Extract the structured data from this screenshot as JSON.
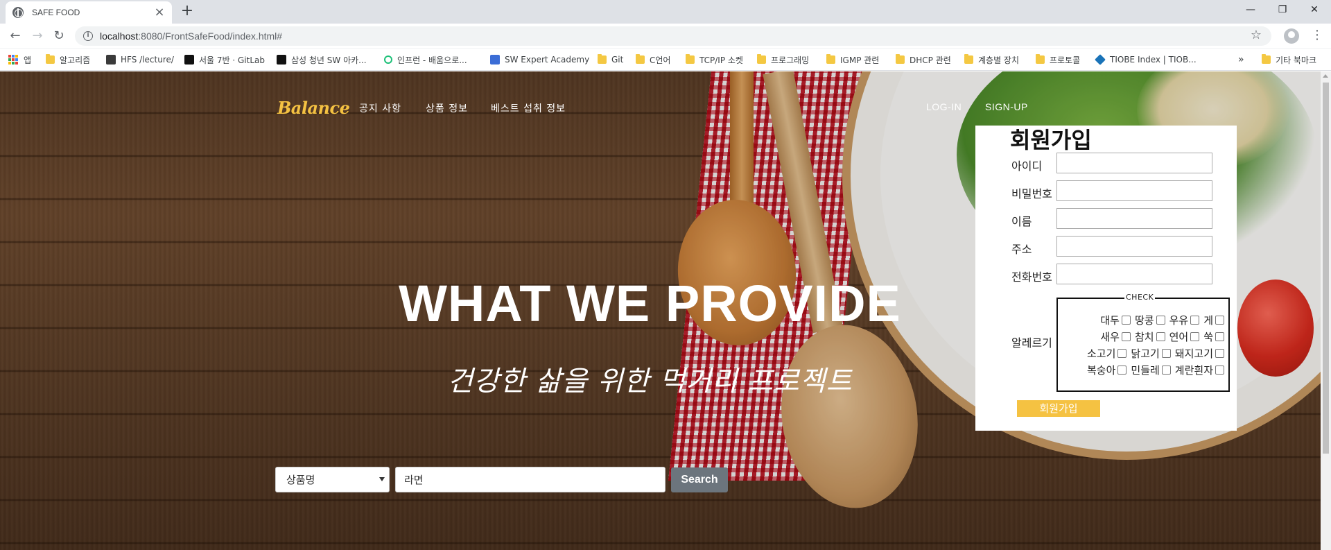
{
  "browser": {
    "tab_title": "SAFE FOOD",
    "tab_close": "×",
    "new_tab": "+",
    "url_host": "localhost",
    "url_path": ":8080/FrontSafeFood/index.html#",
    "window_controls": {
      "minimize": "—",
      "restore": "❐",
      "close": "✕"
    },
    "nav": {
      "back": "←",
      "forward": "→",
      "reload": "↻"
    },
    "star": "☆",
    "menu": "⋮"
  },
  "bookmarks": {
    "items": [
      {
        "label": "앱",
        "icon": "apps-icon"
      },
      {
        "label": "알고리즘",
        "icon": "folder-icon"
      },
      {
        "label": "HFS /lecture/",
        "icon": "hfs-icon"
      },
      {
        "label": "서울 7반 · GitLab",
        "icon": "gitlab-icon"
      },
      {
        "label": "삼성 청년 SW 아카...",
        "icon": "ssafy-icon"
      },
      {
        "label": "인프런 - 배움으로...",
        "icon": "inflearn-icon"
      },
      {
        "label": "SW Expert Academy",
        "icon": "swea-icon"
      },
      {
        "label": "Git",
        "icon": "folder-icon"
      },
      {
        "label": "C언어",
        "icon": "folder-icon"
      },
      {
        "label": "TCP/IP 소켓",
        "icon": "folder-icon"
      },
      {
        "label": "프로그래밍",
        "icon": "folder-icon"
      },
      {
        "label": "IGMP 관련",
        "icon": "folder-icon"
      },
      {
        "label": "DHCP 관련",
        "icon": "folder-icon"
      },
      {
        "label": "계층별 장치",
        "icon": "folder-icon"
      },
      {
        "label": "프로토콜",
        "icon": "folder-icon"
      },
      {
        "label": "TIOBE Index | TIOB...",
        "icon": "tiobe-icon"
      }
    ],
    "overflow": "»",
    "other": "기타 북마크"
  },
  "nav": {
    "brand": "Balance",
    "links": [
      "공지 사항",
      "상품 정보",
      "베스트 섭취 정보"
    ],
    "login": "LOG-IN",
    "signup": "SIGN-UP"
  },
  "hero": {
    "title": "WHAT WE PROVIDE",
    "subtitle": "건강한 삶을 위한 먹거리 프로젝트"
  },
  "search": {
    "select_value": "상품명",
    "input_value": "라면",
    "button": "Search"
  },
  "signup_form": {
    "title": "회원가입",
    "fields": [
      {
        "label": "아이디",
        "value": ""
      },
      {
        "label": "비밀번호",
        "value": ""
      },
      {
        "label": "이름",
        "value": ""
      },
      {
        "label": "주소",
        "value": ""
      },
      {
        "label": "전화번호",
        "value": ""
      }
    ],
    "allergy_label": "알레르기",
    "check_legend": "CHECK",
    "allergy_rows": [
      [
        "대두",
        "땅콩",
        "우유",
        "게"
      ],
      [
        "새우",
        "참치",
        "연어",
        "쑥"
      ],
      [
        "소고기",
        "닭고기",
        "돼지고기"
      ],
      [
        "복숭아",
        "민들레",
        "계란흰자"
      ]
    ],
    "submit": "회원가입"
  },
  "colors": {
    "brand": "#f5c242",
    "submit_bg": "#f5c242",
    "search_btn": "#6c757d"
  }
}
